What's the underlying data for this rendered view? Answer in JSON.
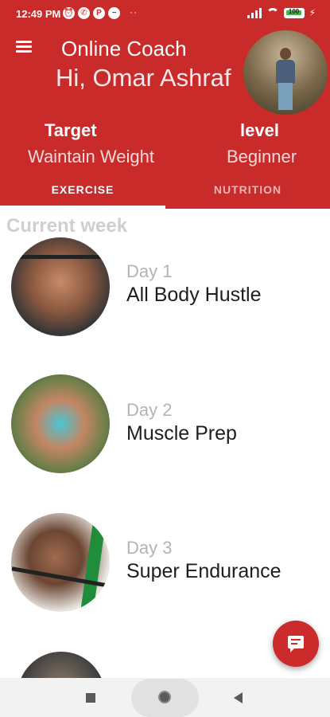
{
  "status_bar": {
    "time": "12:49 PM",
    "battery_level": "100",
    "battery_fraction": 1.0,
    "icons": [
      "alarm-icon",
      "whatsapp-icon",
      "app-icon",
      "minus-circle-icon",
      "signal-icon",
      "wifi-icon",
      "battery-icon",
      "charging-icon"
    ]
  },
  "header": {
    "title": "Online Coach",
    "greeting": "Hi, Omar Ashraf",
    "target_label": "Target",
    "target_value": "Waintain Weight",
    "level_label": "level",
    "level_value": "Beginner",
    "background_color": "#c92a2a"
  },
  "tabs": [
    {
      "label": "EXERCISE",
      "selected": true
    },
    {
      "label": "NUTRITION",
      "selected": false
    }
  ],
  "main": {
    "section_title": "Current week",
    "days": [
      {
        "day": "Day 1",
        "name": "All Body Hustle"
      },
      {
        "day": "Day 2",
        "name": "Muscle Prep"
      },
      {
        "day": "Day 3",
        "name": "Super Endurance"
      }
    ]
  },
  "fab": {
    "icon": "chat-icon",
    "color": "#cc2b2b"
  },
  "nav_bar": {
    "icons": [
      "recents-square-icon",
      "home-circle-icon",
      "back-triangle-icon"
    ]
  }
}
